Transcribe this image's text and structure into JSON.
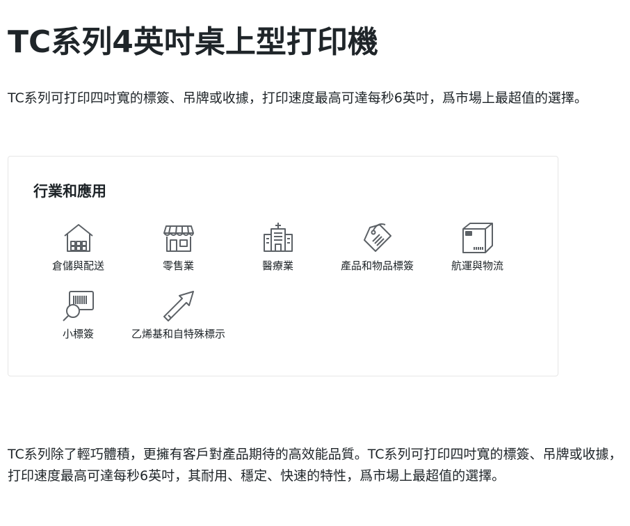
{
  "page": {
    "title": "TC系列4英吋桌上型打印機",
    "intro": "TC系列可打印四吋寬的標簽、吊牌或收據，打印速度最高可達每秒6英吋，爲市場上最超值的選擇。",
    "outro": "TC系列除了輕巧體積，更擁有客戶對產品期待的高效能品質。TC系列可打印四吋寬的標簽、吊牌或收據，打印速度最高可達每秒6英吋，其耐用、穩定、快速的特性，爲市場上最超值的選擇。"
  },
  "industries": {
    "heading": "行業和應用",
    "items": [
      {
        "label": "倉儲與配送",
        "icon": "warehouse-icon"
      },
      {
        "label": "零售業",
        "icon": "storefront-icon"
      },
      {
        "label": "醫療業",
        "icon": "hospital-icon"
      },
      {
        "label": "產品和物品標簽",
        "icon": "tag-icon"
      },
      {
        "label": "航運與物流",
        "icon": "shipping-box-icon"
      },
      {
        "label": "小標簽",
        "icon": "small-label-icon"
      },
      {
        "label": "乙烯基和自特殊標示",
        "icon": "vinyl-arrow-icon"
      }
    ]
  },
  "colors": {
    "text": "#1d2327",
    "icon_stroke": "#5c6166",
    "card_border": "#e6e6e6"
  }
}
